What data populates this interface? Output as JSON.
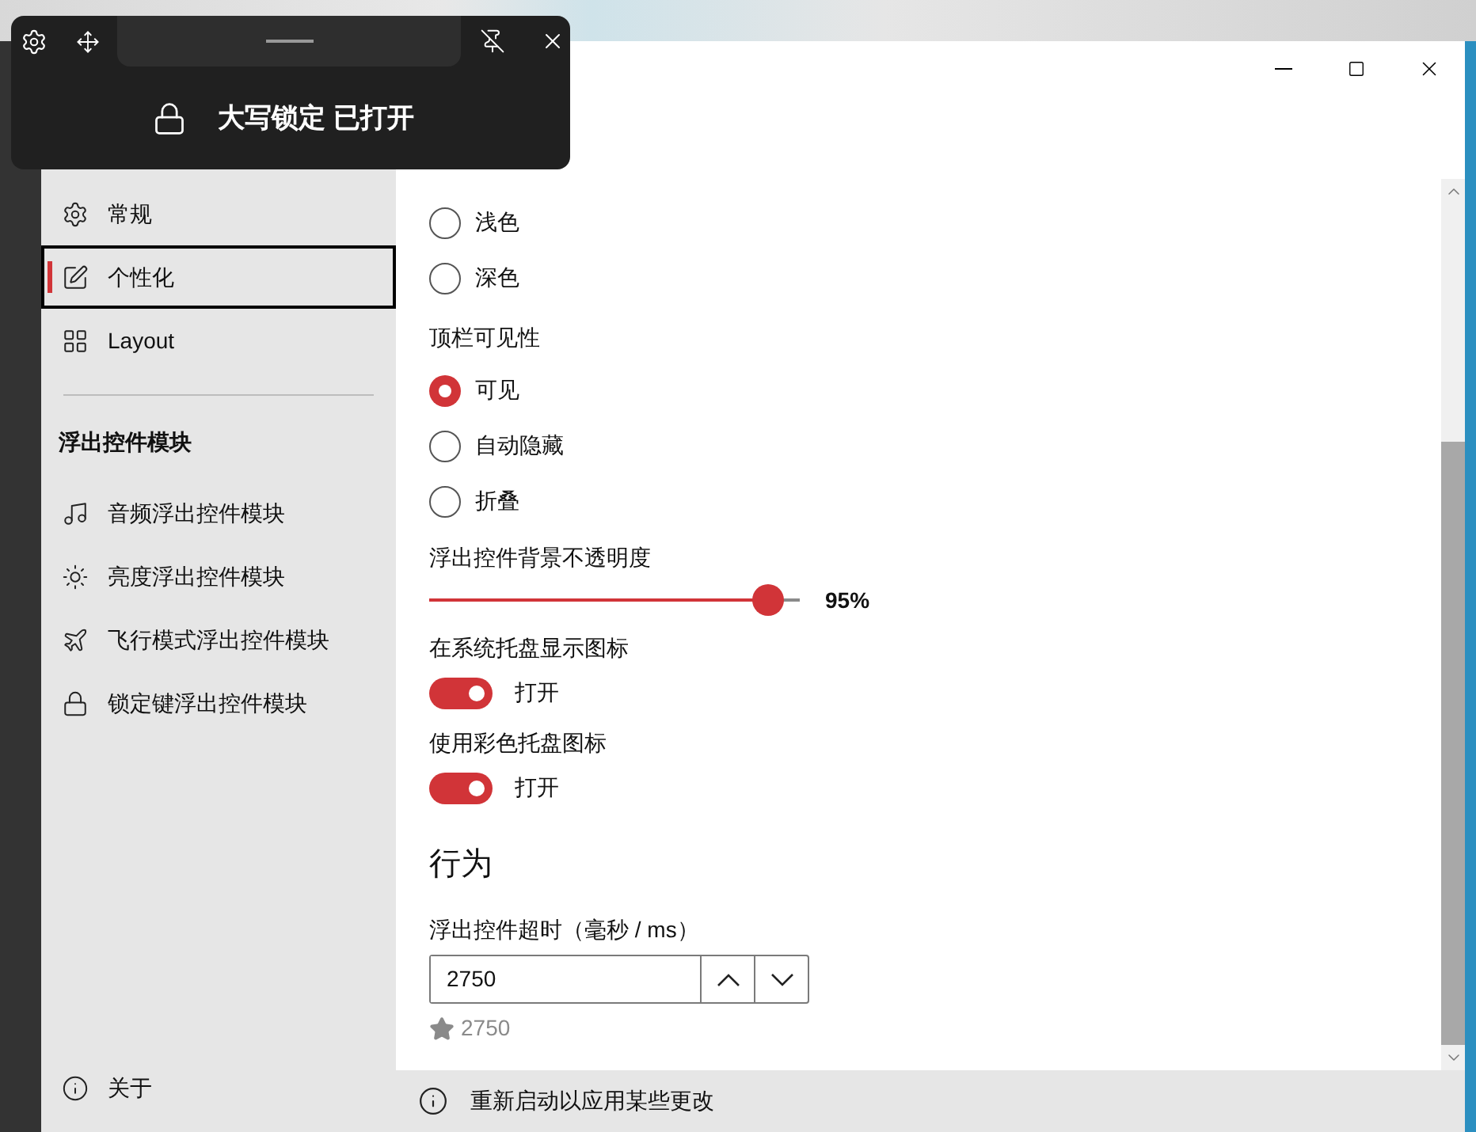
{
  "flyout": {
    "message": "大写锁定 已打开"
  },
  "sidebar": {
    "nav_items": [
      {
        "label": "常规",
        "selected": false
      },
      {
        "label": "个性化",
        "selected": true
      },
      {
        "label": "Layout",
        "selected": false
      }
    ],
    "section_title": "浮出控件模块",
    "module_items": [
      {
        "label": "音频浮出控件模块"
      },
      {
        "label": "亮度浮出控件模块"
      },
      {
        "label": "飞行模式浮出控件模块"
      },
      {
        "label": "锁定键浮出控件模块"
      }
    ],
    "about": "关于"
  },
  "content": {
    "theme_options": [
      {
        "label": "浅色",
        "selected": false
      },
      {
        "label": "深色",
        "selected": false
      }
    ],
    "topbar_visibility": {
      "label": "顶栏可见性",
      "options": [
        {
          "label": "可见",
          "selected": true
        },
        {
          "label": "自动隐藏",
          "selected": false
        },
        {
          "label": "折叠",
          "selected": false
        }
      ]
    },
    "opacity": {
      "label": "浮出控件背景不透明度",
      "level": 0.95,
      "reading": "95%"
    },
    "toggles": [
      {
        "label": "在系统托盘显示图标",
        "on": true,
        "state_text": "打开"
      },
      {
        "label": "使用彩色托盘图标",
        "on": true,
        "state_text": "打开"
      }
    ],
    "behavior": {
      "heading": "行为",
      "timeout_label": "浮出控件超时（毫秒 / ms）",
      "timeout_value": "2750",
      "default_value": "2750"
    }
  },
  "status_bar": {
    "message": "重新启动以应用某些更改"
  }
}
